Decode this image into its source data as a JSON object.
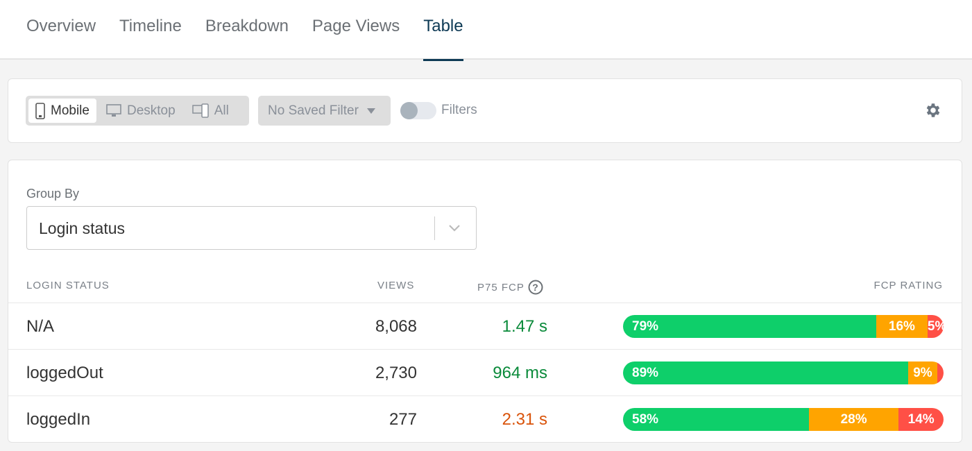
{
  "tabs": [
    {
      "label": "Overview"
    },
    {
      "label": "Timeline"
    },
    {
      "label": "Breakdown"
    },
    {
      "label": "Page Views"
    },
    {
      "label": "Table",
      "active": true
    }
  ],
  "toolbar": {
    "devices": [
      {
        "label": "Mobile",
        "icon": "mobile-icon",
        "active": true
      },
      {
        "label": "Desktop",
        "icon": "desktop-icon"
      },
      {
        "label": "All",
        "icon": "all-devices-icon"
      }
    ],
    "saved_filter": "No Saved Filter",
    "filters_label": "Filters",
    "filters_enabled": false
  },
  "group_by": {
    "label": "Group By",
    "value": "Login status"
  },
  "table": {
    "headers": {
      "name": "LOGIN STATUS",
      "views": "VIEWS",
      "p75": "P75 FCP",
      "rating": "FCP RATING"
    },
    "rows": [
      {
        "name": "N/A",
        "views": "8,068",
        "p75": "1.47 s",
        "p75_color": "#0a8a3a",
        "good": 79,
        "ni": 16,
        "poor": 5,
        "good_label": "79%",
        "ni_label": "16%",
        "poor_label": "5%"
      },
      {
        "name": "loggedOut",
        "views": "2,730",
        "p75": "964 ms",
        "p75_color": "#0a8a3a",
        "good": 89,
        "ni": 9,
        "poor": 2,
        "good_label": "89%",
        "ni_label": "9%",
        "poor_label": ""
      },
      {
        "name": "loggedIn",
        "views": "277",
        "p75": "2.31 s",
        "p75_color": "#d9530a",
        "good": 58,
        "ni": 28,
        "poor": 14,
        "good_label": "58%",
        "ni_label": "28%",
        "poor_label": "14%"
      }
    ]
  },
  "colors": {
    "good": "#0ecf6a",
    "needs_improvement": "#ffa400",
    "poor": "#ff5046",
    "accent": "#0e3a55"
  }
}
